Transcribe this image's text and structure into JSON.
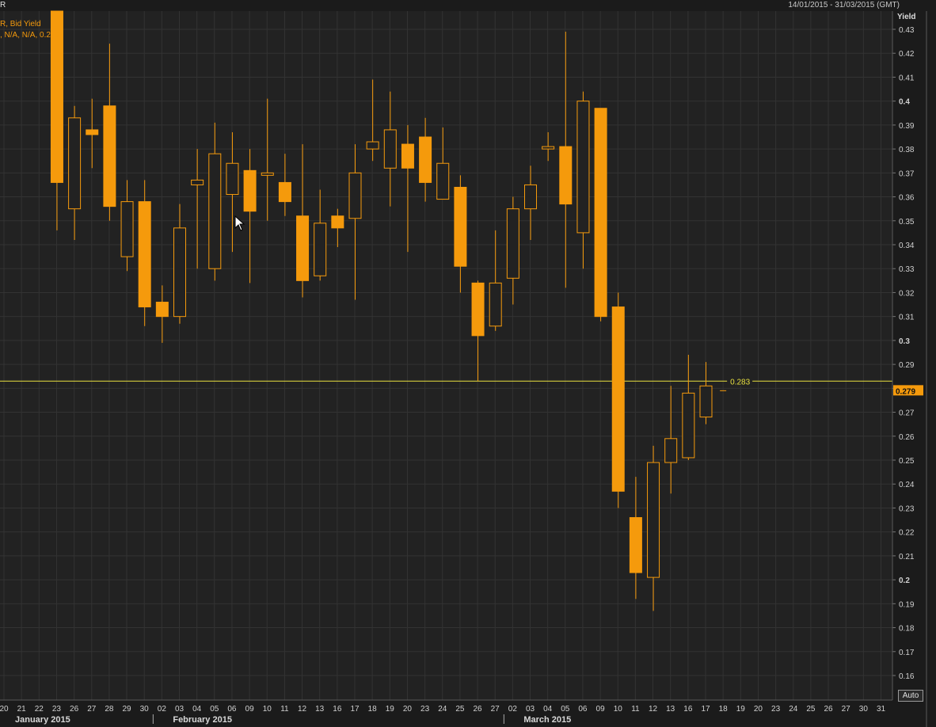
{
  "header": {
    "left_fragment": "R",
    "date_range": "14/01/2015 - 31/03/2015 (GMT)"
  },
  "legend": {
    "line1": "R, Bid Yield",
    "line2": ", N/A, N/A, 0.279"
  },
  "axis": {
    "y_title": "Yield",
    "auto_button": "Auto"
  },
  "colors": {
    "background": "#1b1b1b",
    "plot_background": "#222222",
    "grid": "#333333",
    "candle": "#f59a0c",
    "reference_line": "#e8e040",
    "last_value_bg": "#f59a0c"
  },
  "chart_data": {
    "type": "candlestick",
    "series_name": "Bid Yield",
    "ylabel": "Yield",
    "ylim": [
      0.15,
      0.435
    ],
    "y_ticks": [
      "0.43",
      "0.42",
      "0.41",
      "0.4",
      "0.39",
      "0.38",
      "0.37",
      "0.36",
      "0.35",
      "0.34",
      "0.33",
      "0.32",
      "0.31",
      "0.3",
      "0.29",
      "0.28",
      "0.27",
      "0.26",
      "0.25",
      "0.24",
      "0.23",
      "0.22",
      "0.21",
      "0.2",
      "0.19",
      "0.18",
      "0.17",
      "0.16"
    ],
    "x_ticks": [
      "20",
      "21",
      "22",
      "23",
      "26",
      "27",
      "28",
      "29",
      "30",
      "02",
      "03",
      "04",
      "05",
      "06",
      "09",
      "10",
      "11",
      "12",
      "13",
      "16",
      "17",
      "18",
      "19",
      "20",
      "23",
      "24",
      "25",
      "26",
      "27",
      "02",
      "03",
      "04",
      "05",
      "06",
      "09",
      "10",
      "11",
      "12",
      "13",
      "16",
      "17",
      "18",
      "19",
      "20",
      "23",
      "24",
      "25",
      "26",
      "27",
      "30",
      "31"
    ],
    "months": [
      {
        "label": "January 2015",
        "at_tick": 0
      },
      {
        "label": "February 2015",
        "at_tick": 9
      },
      {
        "label": "March 2015",
        "at_tick": 29
      }
    ],
    "candles": [
      {
        "date": "2015-01-23",
        "open": 0.44,
        "high": 0.44,
        "low": 0.346,
        "close": 0.366
      },
      {
        "date": "2015-01-26",
        "open": 0.355,
        "high": 0.398,
        "low": 0.342,
        "close": 0.393
      },
      {
        "date": "2015-01-27",
        "open": 0.388,
        "high": 0.401,
        "low": 0.372,
        "close": 0.386
      },
      {
        "date": "2015-01-28",
        "open": 0.398,
        "high": 0.424,
        "low": 0.35,
        "close": 0.356
      },
      {
        "date": "2015-01-29",
        "open": 0.335,
        "high": 0.367,
        "low": 0.329,
        "close": 0.358
      },
      {
        "date": "2015-01-30",
        "open": 0.358,
        "high": 0.367,
        "low": 0.306,
        "close": 0.314
      },
      {
        "date": "2015-02-02",
        "open": 0.316,
        "high": 0.323,
        "low": 0.299,
        "close": 0.31
      },
      {
        "date": "2015-02-03",
        "open": 0.31,
        "high": 0.357,
        "low": 0.307,
        "close": 0.347
      },
      {
        "date": "2015-02-04",
        "open": 0.365,
        "high": 0.38,
        "low": 0.33,
        "close": 0.367
      },
      {
        "date": "2015-02-05",
        "open": 0.33,
        "high": 0.391,
        "low": 0.325,
        "close": 0.378
      },
      {
        "date": "2015-02-06",
        "open": 0.361,
        "high": 0.387,
        "low": 0.337,
        "close": 0.374
      },
      {
        "date": "2015-02-09",
        "open": 0.371,
        "high": 0.38,
        "low": 0.324,
        "close": 0.354
      },
      {
        "date": "2015-02-10",
        "open": 0.369,
        "high": 0.401,
        "low": 0.35,
        "close": 0.37
      },
      {
        "date": "2015-02-11",
        "open": 0.366,
        "high": 0.378,
        "low": 0.352,
        "close": 0.358
      },
      {
        "date": "2015-02-12",
        "open": 0.352,
        "high": 0.382,
        "low": 0.318,
        "close": 0.325
      },
      {
        "date": "2015-02-13",
        "open": 0.327,
        "high": 0.363,
        "low": 0.325,
        "close": 0.349
      },
      {
        "date": "2015-02-16",
        "open": 0.352,
        "high": 0.355,
        "low": 0.339,
        "close": 0.347
      },
      {
        "date": "2015-02-17",
        "open": 0.351,
        "high": 0.382,
        "low": 0.317,
        "close": 0.37
      },
      {
        "date": "2015-02-18",
        "open": 0.38,
        "high": 0.409,
        "low": 0.375,
        "close": 0.383
      },
      {
        "date": "2015-02-19",
        "open": 0.372,
        "high": 0.404,
        "low": 0.356,
        "close": 0.388
      },
      {
        "date": "2015-02-20",
        "open": 0.382,
        "high": 0.39,
        "low": 0.337,
        "close": 0.372
      },
      {
        "date": "2015-02-23",
        "open": 0.385,
        "high": 0.393,
        "low": 0.358,
        "close": 0.366
      },
      {
        "date": "2015-02-24",
        "open": 0.359,
        "high": 0.389,
        "low": 0.359,
        "close": 0.374
      },
      {
        "date": "2015-02-25",
        "open": 0.364,
        "high": 0.369,
        "low": 0.32,
        "close": 0.331
      },
      {
        "date": "2015-02-26",
        "open": 0.324,
        "high": 0.325,
        "low": 0.283,
        "close": 0.302
      },
      {
        "date": "2015-02-27",
        "open": 0.306,
        "high": 0.346,
        "low": 0.304,
        "close": 0.324
      },
      {
        "date": "2015-03-02",
        "open": 0.326,
        "high": 0.36,
        "low": 0.315,
        "close": 0.355
      },
      {
        "date": "2015-03-03",
        "open": 0.355,
        "high": 0.373,
        "low": 0.342,
        "close": 0.365
      },
      {
        "date": "2015-03-04",
        "open": 0.38,
        "high": 0.387,
        "low": 0.375,
        "close": 0.381
      },
      {
        "date": "2015-03-05",
        "open": 0.381,
        "high": 0.429,
        "low": 0.322,
        "close": 0.357
      },
      {
        "date": "2015-03-06",
        "open": 0.345,
        "high": 0.404,
        "low": 0.33,
        "close": 0.4
      },
      {
        "date": "2015-03-09",
        "open": 0.397,
        "high": 0.397,
        "low": 0.308,
        "close": 0.31
      },
      {
        "date": "2015-03-10",
        "open": 0.314,
        "high": 0.32,
        "low": 0.23,
        "close": 0.237
      },
      {
        "date": "2015-03-11",
        "open": 0.226,
        "high": 0.243,
        "low": 0.192,
        "close": 0.203
      },
      {
        "date": "2015-03-12",
        "open": 0.201,
        "high": 0.256,
        "low": 0.187,
        "close": 0.249
      },
      {
        "date": "2015-03-13",
        "open": 0.249,
        "high": 0.281,
        "low": 0.236,
        "close": 0.259
      },
      {
        "date": "2015-03-16",
        "open": 0.251,
        "high": 0.294,
        "low": 0.25,
        "close": 0.278
      },
      {
        "date": "2015-03-17",
        "open": 0.268,
        "high": 0.291,
        "low": 0.265,
        "close": 0.281
      }
    ],
    "reference_line": {
      "value": 0.283,
      "label": "0.283"
    },
    "last_value": {
      "value": 0.279,
      "label": "0.279"
    },
    "grid": true
  }
}
